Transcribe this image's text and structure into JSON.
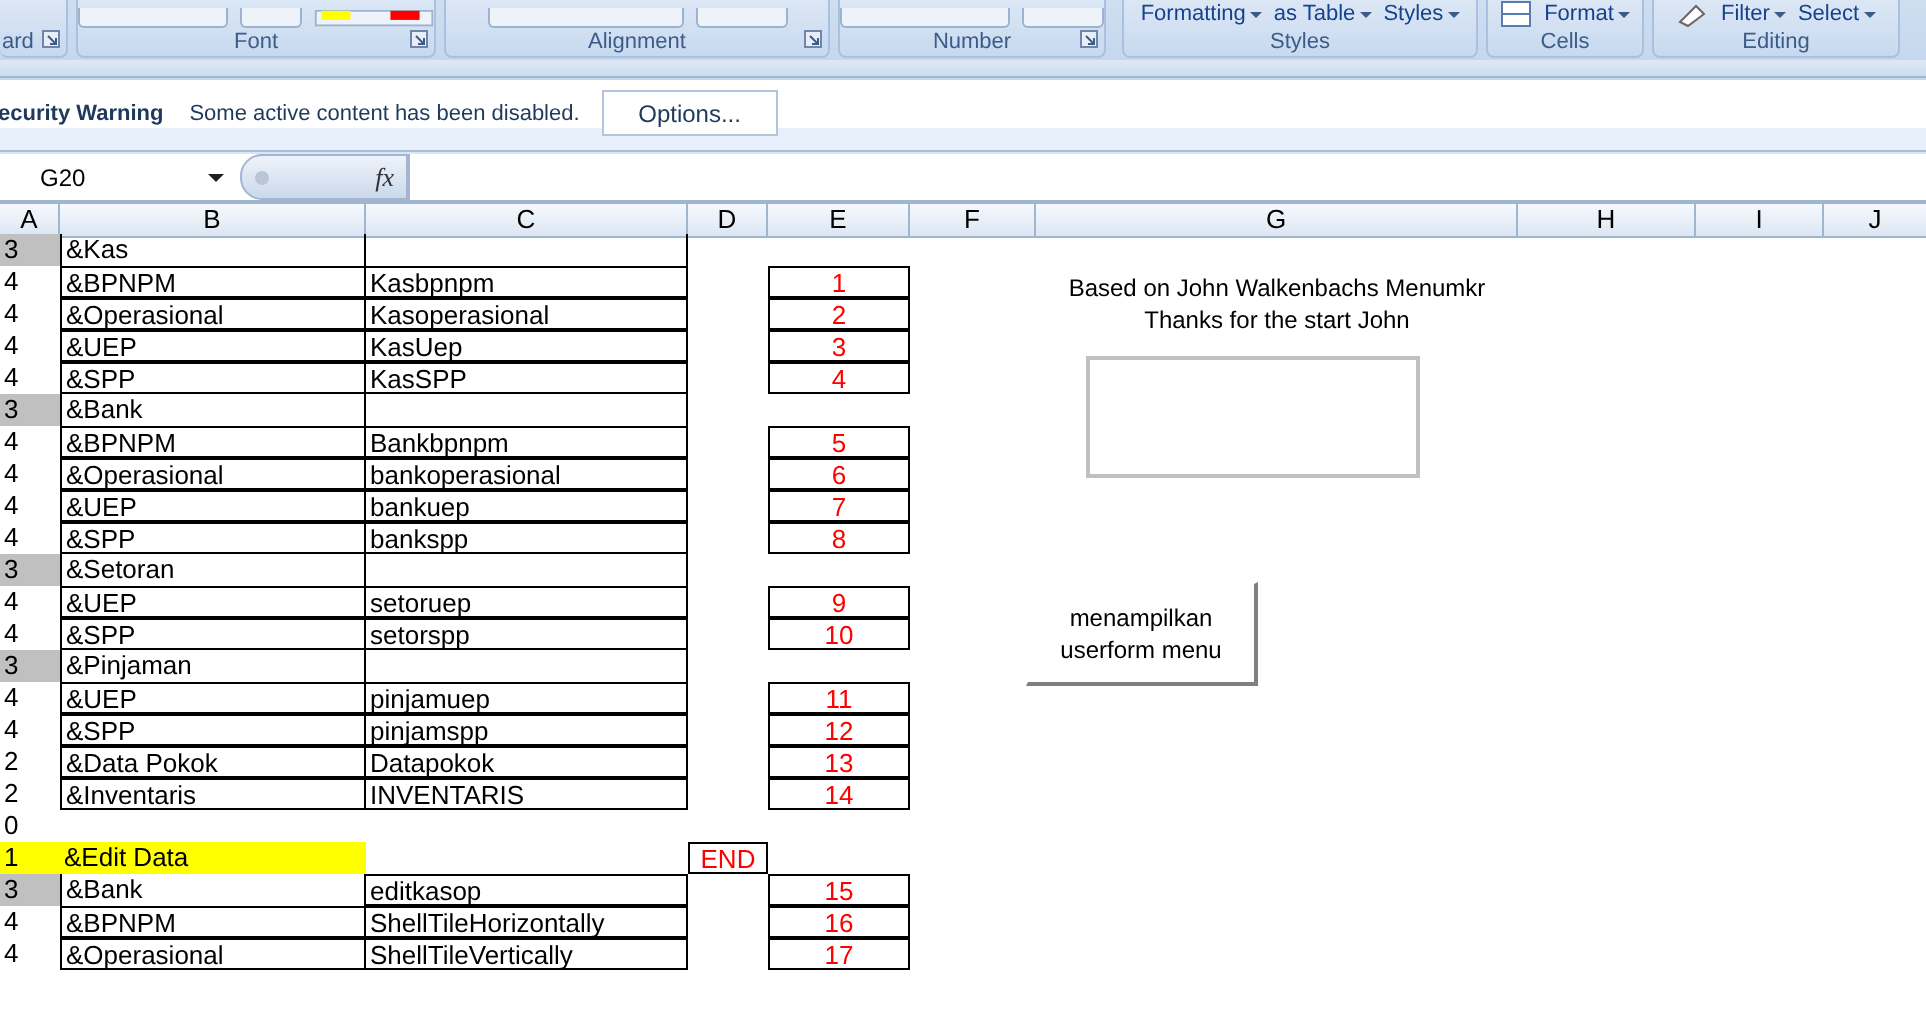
{
  "ribbon": {
    "groups": [
      {
        "label": "ard",
        "launcher": true
      },
      {
        "label": "Font",
        "launcher": true
      },
      {
        "label": "Alignment",
        "launcher": true
      },
      {
        "label": "Number",
        "launcher": true
      },
      {
        "label": "Styles",
        "launcher": false,
        "buttons": [
          "Formatting",
          "as Table",
          "Styles"
        ]
      },
      {
        "label": "Cells",
        "launcher": false,
        "buttons": [
          "Format"
        ]
      },
      {
        "label": "Editing",
        "launcher": false,
        "buttons": [
          "Filter",
          "Select"
        ]
      }
    ]
  },
  "security_bar": {
    "title": "ecurity Warning",
    "message": "Some active content has been disabled.",
    "button": "Options..."
  },
  "formula_bar": {
    "name_box": "G20",
    "fx": "fx"
  },
  "sheet": {
    "columns": [
      "A",
      "B",
      "C",
      "D",
      "E",
      "F",
      "G",
      "H",
      "I",
      "J"
    ],
    "rows": [
      {
        "kind": "group",
        "a": "3",
        "b": "&Kas",
        "c": "",
        "d": "",
        "e": ""
      },
      {
        "kind": "item",
        "a": "4",
        "b": "&BPNPM",
        "c": "Kasbpnpm",
        "d": "",
        "e": "1"
      },
      {
        "kind": "item",
        "a": "4",
        "b": "&Operasional",
        "c": "Kasoperasional",
        "d": "",
        "e": "2"
      },
      {
        "kind": "item",
        "a": "4",
        "b": "&UEP",
        "c": "KasUep",
        "d": "",
        "e": "3"
      },
      {
        "kind": "item",
        "a": "4",
        "b": "&SPP",
        "c": "KasSPP",
        "d": "",
        "e": "4"
      },
      {
        "kind": "group",
        "a": "3",
        "b": "&Bank",
        "c": "",
        "d": "",
        "e": ""
      },
      {
        "kind": "item",
        "a": "4",
        "b": "&BPNPM",
        "c": "Bankbpnpm",
        "d": "",
        "e": "5"
      },
      {
        "kind": "item",
        "a": "4",
        "b": "&Operasional",
        "c": "bankoperasional",
        "d": "",
        "e": "6"
      },
      {
        "kind": "item",
        "a": "4",
        "b": "&UEP",
        "c": "bankuep",
        "d": "",
        "e": "7"
      },
      {
        "kind": "item",
        "a": "4",
        "b": "&SPP",
        "c": "bankspp",
        "d": "",
        "e": "8"
      },
      {
        "kind": "group",
        "a": "3",
        "b": "&Setoran",
        "c": "",
        "d": "",
        "e": ""
      },
      {
        "kind": "item",
        "a": "4",
        "b": "&UEP",
        "c": "setoruep",
        "d": "",
        "e": "9"
      },
      {
        "kind": "item",
        "a": "4",
        "b": "&SPP",
        "c": "setorspp",
        "d": "",
        "e": "10"
      },
      {
        "kind": "group",
        "a": "3",
        "b": "&Pinjaman",
        "c": "",
        "d": "",
        "e": ""
      },
      {
        "kind": "item",
        "a": "4",
        "b": "&UEP",
        "c": "pinjamuep",
        "d": "",
        "e": "11"
      },
      {
        "kind": "item",
        "a": "4",
        "b": "&SPP",
        "c": "pinjamspp",
        "d": "",
        "e": "12"
      },
      {
        "kind": "item",
        "a": "2",
        "b": "&Data Pokok",
        "c": "Datapokok",
        "d": "",
        "e": "13"
      },
      {
        "kind": "item",
        "a": "2",
        "b": "&Inventaris",
        "c": "INVENTARIS",
        "d": "",
        "e": "14"
      },
      {
        "kind": "spacer",
        "a": "0",
        "b": "",
        "c": "",
        "d": "",
        "e": ""
      },
      {
        "kind": "section",
        "a": "1",
        "b": "&Edit Data",
        "c": "",
        "d": "END",
        "e": ""
      },
      {
        "kind": "group",
        "a": "3",
        "b": "&Bank",
        "c": "editkasop",
        "d": "",
        "e": "15"
      },
      {
        "kind": "item",
        "a": "4",
        "b": "&BPNPM",
        "c": "ShellTileHorizontally",
        "d": "",
        "e": "16"
      },
      {
        "kind": "item",
        "a": "4",
        "b": "&Operasional",
        "c": "ShellTileVertically",
        "d": "",
        "e": "17"
      }
    ],
    "note": [
      "Based on John Walkenbachs Menumkr",
      "Thanks for the start John"
    ],
    "macro_button": [
      "menampilkan",
      "userform menu"
    ]
  }
}
